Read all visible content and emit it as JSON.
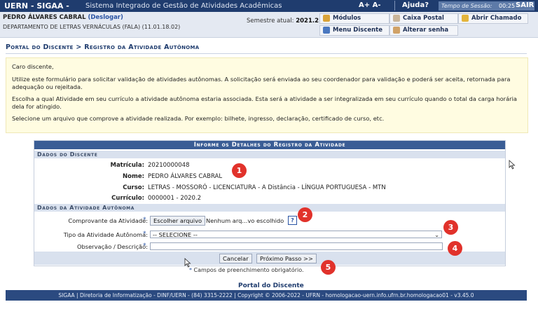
{
  "header": {
    "brand": "UERN - SIGAA -",
    "system_name": "Sistema Integrado de Gestão de Atividades Acadêmicas",
    "font_controls": "A+  A-",
    "help": "Ajuda?",
    "session_label": "Tempo de Sessão:",
    "session_time": "00:25",
    "exit": "SAIR"
  },
  "user": {
    "name": "PEDRO ÁLVARES CABRAL",
    "logout": "(Deslogar)",
    "department": "DEPARTAMENTO DE LETRAS VERNÁCULAS (FALA) (11.01.18.02)",
    "semester_label": "Semestre atual:",
    "semester_value": "2021.2"
  },
  "menu": {
    "modulos": "Módulos",
    "caixa_postal": "Caixa Postal",
    "abrir_chamado": "Abrir Chamado",
    "menu_discente": "Menu Discente",
    "alterar_senha": "Alterar senha"
  },
  "breadcrumb": "Portal do Discente > Registro da Atividade Autônoma",
  "info": {
    "greeting": "Caro discente,",
    "p1": "Utilize este formulário para solicitar validação de atividades autônomas. A solicitação será enviada ao seu coordenador para validação e poderá ser aceita, retornada para adequação ou rejeitada.",
    "p2": "Escolha a qual Atividade em seu currículo a atividade autônoma estaria associada. Esta será a atividade a ser integralizada em seu currículo quando o total da carga horária dela for atingido.",
    "p3": "Selecione um arquivo que comprove a atividade realizada. Por exemplo: bilhete, ingresso, declaração, certificado de curso, etc."
  },
  "form": {
    "title": "Informe os Detalhes do Registro da Atividade",
    "section_student": "Dados do Discente",
    "matricula_label": "Matrícula:",
    "matricula_value": "20210000048",
    "nome_label": "Nome:",
    "nome_value": "PEDRO ÁLVARES CABRAL",
    "curso_label": "Curso:",
    "curso_value": "LETRAS - MOSSORÓ - LICENCIATURA - A Distância - LÍNGUA PORTUGUESA - MTN",
    "curriculo_label": "Currículo:",
    "curriculo_value": "0000001 - 2020.2",
    "section_activity": "Dados da Atividade Autônoma",
    "comprovante_label": "Comprovante da Atividade:",
    "choose_file": "Escolher arquivo",
    "no_file": "Nenhum arq...vo escolhido",
    "help_icon": "?",
    "tipo_label": "Tipo da Atividade Autônoma:",
    "tipo_selected": "-- SELECIONE --",
    "obs_label": "Observação / Descrição:",
    "obs_value": "",
    "required_star": "*",
    "cancel": "Cancelar",
    "next": "Próximo Passo >>"
  },
  "markers": [
    "1",
    "2",
    "3",
    "4",
    "5"
  ],
  "required_note": "Campos de preenchimento obrigatório.",
  "portal_link": "Portal do Discente",
  "footer": "SIGAA | Diretoria de Informatização - DINF/UERN - (84) 3315-2222 | Copyright © 2006-2022 - UFRN - homologacao-uern.info.ufrn.br.homologacao01 - v3.45.0",
  "colors": {
    "header_bg": "#1f3c6e",
    "form_title_bg": "#3a5d95",
    "section_bg": "#d9e1ee",
    "info_bg": "#fffce1",
    "marker": "#e1322b",
    "required": "#2a54a4"
  }
}
